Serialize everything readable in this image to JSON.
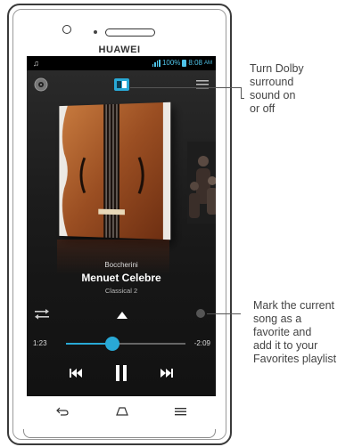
{
  "device": {
    "brand": "HUAWEI"
  },
  "status_bar": {
    "notification_icon": "music-note-icon",
    "battery_percent": "100%",
    "time": "8:08",
    "ampm": "AM"
  },
  "player": {
    "top_icons": [
      "disc-icon",
      "dolby-icon",
      "menu-icon"
    ],
    "artist": "Boccherini",
    "title": "Menuet Celebre",
    "album": "Classical 2",
    "elapsed": "1:23",
    "remaining": "-2:09",
    "progress_fraction": 0.39,
    "accent_color": "#29a9d6"
  },
  "callouts": {
    "dolby": [
      "Turn Dolby",
      "surround",
      "sound on",
      "or off"
    ],
    "favorite": [
      "Mark the current",
      "song as a",
      "favorite and",
      "add it to your",
      "Favorites playlist"
    ]
  }
}
